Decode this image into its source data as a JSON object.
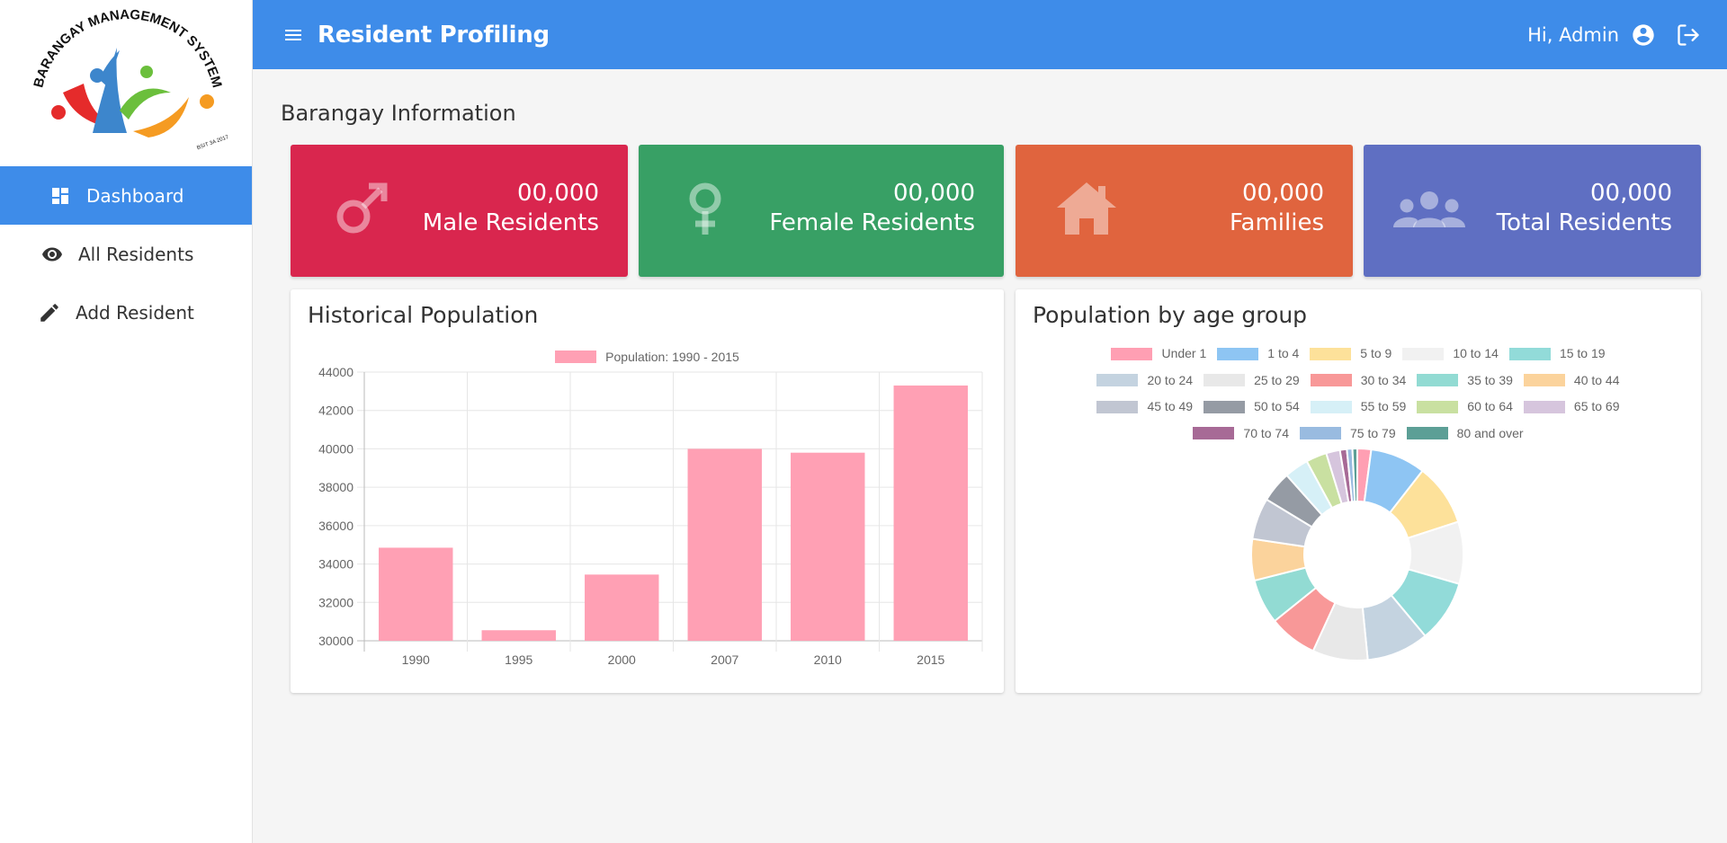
{
  "sidebar": {
    "logo": {
      "arc_text": "BARANGAY MANAGEMENT SYSTEM",
      "sub_text": "BSIT 3A 2017"
    },
    "items": [
      {
        "label": "Dashboard",
        "icon": "dashboard-icon",
        "active": true
      },
      {
        "label": "All Residents",
        "icon": "eye-icon",
        "active": false
      },
      {
        "label": "Add Resident",
        "icon": "pencil-icon",
        "active": false
      }
    ]
  },
  "header": {
    "title": "Resident Profiling",
    "greeting": "Hi, Admin",
    "accent_color": "#3e8ce9"
  },
  "main": {
    "section_title": "Barangay Information",
    "stats": [
      {
        "value": "00,000",
        "label": "Male Residents",
        "icon": "male-icon",
        "color": "#d9264e"
      },
      {
        "value": "00,000",
        "label": "Female Residents",
        "icon": "female-icon",
        "color": "#38a065"
      },
      {
        "value": "00,000",
        "label": "Families",
        "icon": "home-icon",
        "color": "#e0643e"
      },
      {
        "value": "00,000",
        "label": "Total Residents",
        "icon": "people-icon",
        "color": "#5f6fc2"
      }
    ],
    "historical_title": "Historical Population",
    "age_title": "Population by age group"
  },
  "chart_data": [
    {
      "type": "bar",
      "title": "Historical Population",
      "categories": [
        "1990",
        "1995",
        "2000",
        "2007",
        "2010",
        "2015"
      ],
      "series": [
        {
          "name": "Population: 1990 - 2015",
          "values": [
            34850,
            30550,
            33450,
            40000,
            39800,
            43300
          ],
          "color": "#ffa0b4"
        }
      ],
      "ylim": [
        30000,
        44000
      ],
      "yticks": [
        30000,
        32000,
        34000,
        36000,
        38000,
        40000,
        42000,
        44000
      ],
      "grid": true,
      "legend": "top"
    },
    {
      "type": "pie",
      "variant": "doughnut",
      "title": "Population by age group",
      "categories": [
        "Under 1",
        "1 to 4",
        "5 to 9",
        "10 to 14",
        "15 to 19",
        "20 to 24",
        "25 to 29",
        "30 to 34",
        "35 to 39",
        "40 to 44",
        "45 to 49",
        "50 to 54",
        "55 to 59",
        "60 to 64",
        "65 to 69",
        "70 to 74",
        "75 to 79",
        "80 and over"
      ],
      "values": [
        2.0,
        8.0,
        9.0,
        9.0,
        9.0,
        9.0,
        8.0,
        7.0,
        6.5,
        6.0,
        6.0,
        4.5,
        3.5,
        3.0,
        2.0,
        1.0,
        0.8,
        0.7
      ],
      "colors": [
        "#ff9fb3",
        "#8ec5f3",
        "#fde19a",
        "#f1f1f1",
        "#92dbd9",
        "#c4d3e0",
        "#e8e8e8",
        "#f89898",
        "#92dbd3",
        "#fbd39c",
        "#c1c6d2",
        "#959ba4",
        "#d6f0f7",
        "#c9e0a1",
        "#d6c5dd",
        "#a76a96",
        "#99bbe0",
        "#5c9f96"
      ],
      "legend": "top"
    }
  ]
}
